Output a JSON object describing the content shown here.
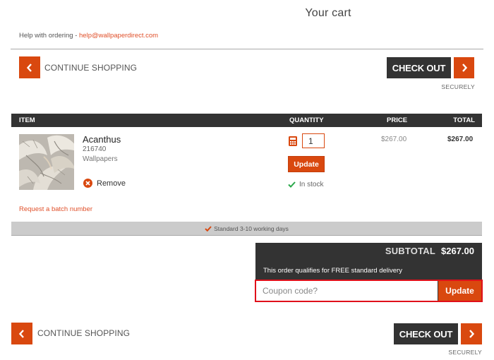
{
  "header": {
    "title": "Your cart",
    "help_text": "Help with ordering - ",
    "help_email": "help@wallpaperdirect.com"
  },
  "nav": {
    "continue_shopping": "CONTINUE SHOPPING",
    "check_out": "CHECK OUT",
    "securely": "SECURELY"
  },
  "table": {
    "columns": [
      "ITEM",
      "QUANTITY",
      "PRICE",
      "TOTAL"
    ],
    "items": [
      {
        "name": "Acanthus",
        "sku": "216740",
        "category": "Wallpapers",
        "remove_label": "Remove",
        "quantity": "1",
        "update_label": "Update",
        "stock_status": "In stock",
        "price": "$267.00",
        "total": "$267.00"
      }
    ]
  },
  "batch_link": "Request a batch number",
  "delivery": {
    "text": "Standard 3-10 working days"
  },
  "summary": {
    "subtotal_label": "SUBTOTAL",
    "subtotal_value": "$267.00",
    "free_delivery_text": "This order qualifies for FREE standard delivery",
    "coupon_placeholder": "Coupon code?",
    "coupon_value": "",
    "coupon_button": "Update"
  },
  "colors": {
    "accent": "#d9480f",
    "dark": "#333333",
    "link": "#e0502a",
    "success": "#2aa84a",
    "highlight": "#e0101a"
  }
}
